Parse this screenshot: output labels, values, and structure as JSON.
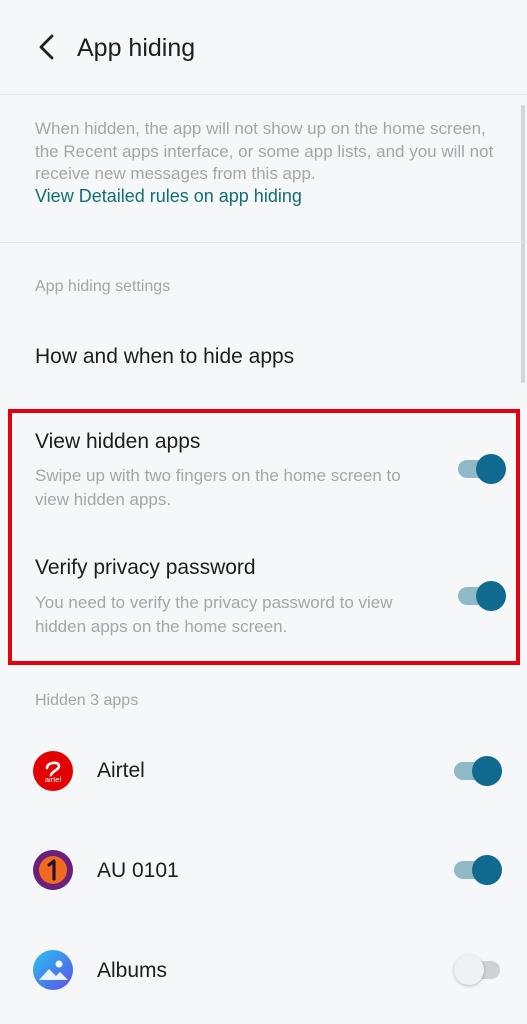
{
  "header": {
    "title": "App hiding",
    "back_icon": "chevron-left-icon"
  },
  "intro": {
    "text": "When hidden, the app will not show up on the home screen, the Recent apps interface, or some app lists, and you will not receive new messages from this app.",
    "link": "View Detailed rules on app hiding"
  },
  "settings": {
    "section_label": "App hiding settings",
    "how_when_label": "How and when to hide apps",
    "view_hidden": {
      "title": "View hidden apps",
      "subtitle": "Swipe up with two fingers on the home screen to view hidden apps.",
      "enabled": true
    },
    "verify_password": {
      "title": "Verify privacy password",
      "subtitle": "You need to verify the privacy password to view hidden apps on the home screen.",
      "enabled": true
    }
  },
  "apps": {
    "section_label": "Hidden 3 apps",
    "items": [
      {
        "name": "Airtel",
        "icon": "airtel-icon",
        "icon_text": "airtel",
        "hidden": true
      },
      {
        "name": "AU 0101",
        "icon": "au-0101-icon",
        "hidden": true
      },
      {
        "name": "Albums",
        "icon": "albums-icon",
        "hidden": false
      }
    ]
  },
  "colors": {
    "accent": "#106a90",
    "link": "#0f6f74",
    "highlight": "#e3000f"
  }
}
